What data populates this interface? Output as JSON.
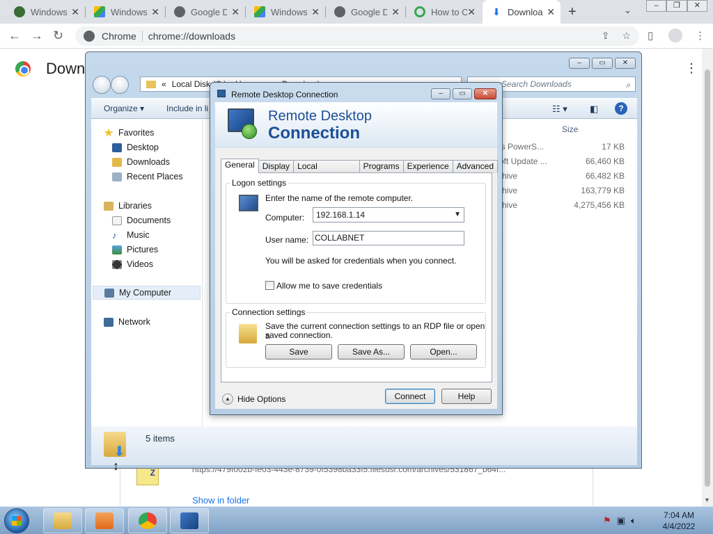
{
  "browser": {
    "tabs": [
      {
        "label": "Windows",
        "favicon": "globe-dark-icon",
        "color": "#3a6b35"
      },
      {
        "label": "Windows",
        "favicon": "google-drive-icon",
        "color": "#fbbc05"
      },
      {
        "label": "Google D",
        "favicon": "globe-icon",
        "color": "#5f6368"
      },
      {
        "label": "Windows",
        "favicon": "google-drive-icon",
        "color": "#34a853"
      },
      {
        "label": "Google D",
        "favicon": "globe-icon",
        "color": "#5f6368"
      },
      {
        "label": "How to C",
        "favicon": "refresh-green-icon",
        "color": "#34a853"
      },
      {
        "label": "Downloa",
        "favicon": "download-icon",
        "color": "#1a73e8",
        "active": true
      }
    ],
    "new_tab": "+",
    "omnibox": {
      "site": "Chrome",
      "url": "chrome://downloads"
    }
  },
  "downloads_page": {
    "title": "Down",
    "item_url": "https://479f002b-fe03-443e-8739-0f5398ba33f5.filesusr.com/archives/531867_b64f...",
    "show_in_folder": "Show in folder"
  },
  "explorer": {
    "address": "Local Disk (C:) ▸ Users ▸ ... ▸ Downloads",
    "address_prefix": "«",
    "search_placeholder": "Search Downloads",
    "commands": {
      "organize": "Organize ▾",
      "include": "Include in li"
    },
    "nav": {
      "favorites": "Favorites",
      "desktop": "Desktop",
      "downloads": "Downloads",
      "recent": "Recent Places",
      "libraries": "Libraries",
      "documents": "Documents",
      "music": "Music",
      "pictures": "Pictures",
      "videos": "Videos",
      "computer": "My Computer",
      "network": "Network"
    },
    "size_header": "Size",
    "files": [
      {
        "type": "ws PowerS...",
        "size": "17 KB"
      },
      {
        "type": "soft Update ...",
        "size": "66,460 KB"
      },
      {
        "type": "rchive",
        "size": "66,482 KB"
      },
      {
        "type": "rchive",
        "size": "163,779 KB"
      },
      {
        "type": "rchive",
        "size": "4,275,456 KB"
      }
    ],
    "status_count": "5 items"
  },
  "rdp": {
    "title": "Remote Desktop Connection",
    "banner_line1": "Remote Desktop",
    "banner_line2": "Connection",
    "tabs": [
      "General",
      "Display",
      "Local Resources",
      "Programs",
      "Experience",
      "Advanced"
    ],
    "logon_legend": "Logon settings",
    "logon_intro": "Enter the name of the remote computer.",
    "computer_label": "Computer:",
    "computer_value": "192.168.1.14",
    "username_label": "User name:",
    "username_value": "COLLABNET",
    "credentials_note": "You will be asked for credentials when you connect.",
    "allow_save_label": "Allow me to save credentials",
    "allow_save_checked": false,
    "connection_legend": "Connection settings",
    "connection_text_1": "Save the current connection settings to an RDP file or open a",
    "connection_text_2": "saved connection.",
    "save_btn": "Save",
    "save_as_btn": "Save As...",
    "open_btn": "Open...",
    "hide_options": "Hide Options",
    "connect_btn": "Connect",
    "help_btn": "Help"
  },
  "taskbar": {
    "clock_time": "7:04 AM",
    "clock_date": "4/4/2022"
  }
}
